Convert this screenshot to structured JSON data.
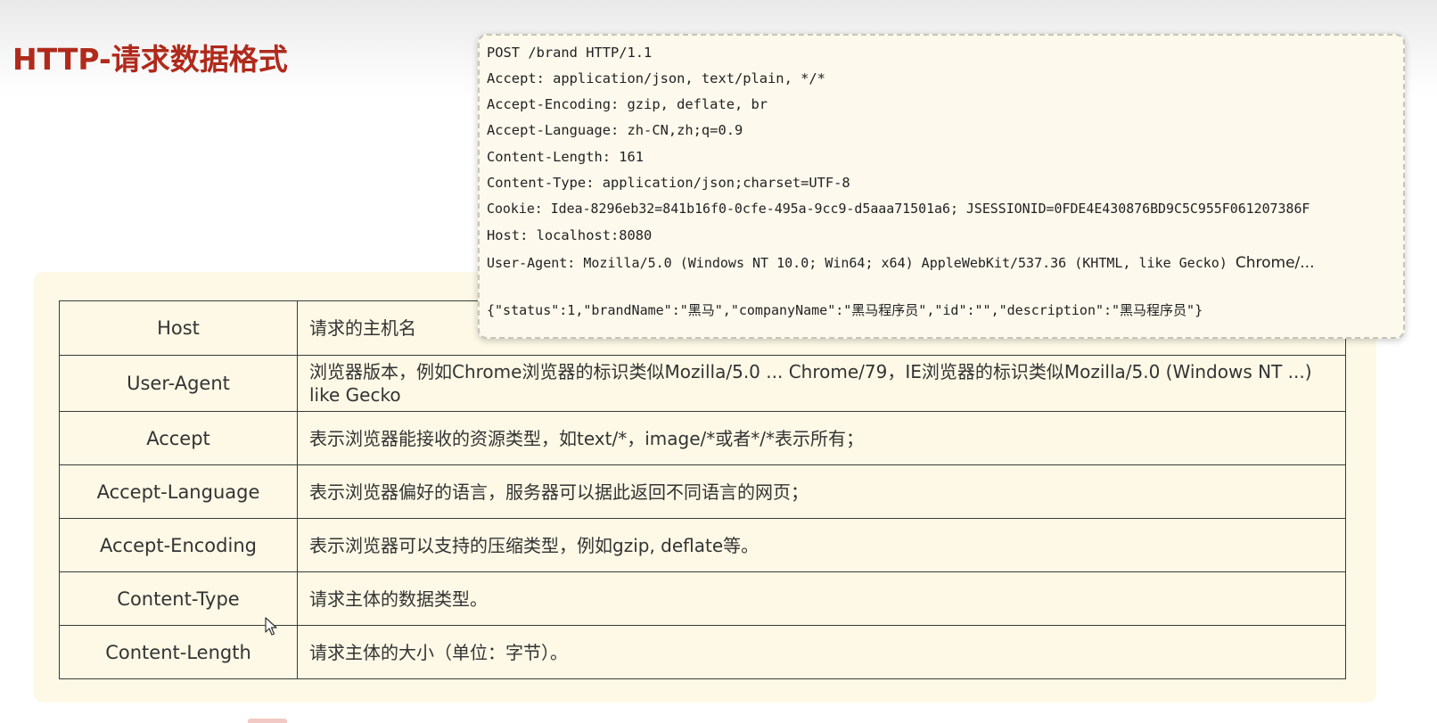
{
  "slide": {
    "title": "HTTP-请求数据格式"
  },
  "request_example": {
    "request_line": "POST /brand HTTP/1.1",
    "headers": [
      "Accept: application/json, text/plain, */*",
      "Accept-Encoding: gzip, deflate, br",
      "Accept-Language: zh-CN,zh;q=0.9",
      "Content-Length: 161",
      "Content-Type: application/json;charset=UTF-8",
      "Cookie: Idea-8296eb32=841b16f0-0cfe-495a-9cc9-d5aaa71501a6; JSESSIONID=0FDE4E430876BD9C5C955F061207386F",
      "Host: localhost:8080"
    ],
    "user_agent": "User-Agent: Mozilla/5.0 (Windows NT 10.0; Win64; x64) AppleWebKit/537.36 (KHTML, like Gecko)",
    "user_agent_tail": "Chrome/...",
    "body": "{\"status\":1,\"brandName\":\"黑马\",\"companyName\":\"黑马程序员\",\"id\":\"\",\"description\":\"黑马程序员\"}"
  },
  "header_table": {
    "rows": [
      {
        "name": "Host",
        "description": "请求的主机名"
      },
      {
        "name": "User-Agent",
        "description": "浏览器版本，例如Chrome浏览器的标识类似Mozilla/5.0 ... Chrome/79，IE浏览器的标识类似Mozilla/5.0 (Windows NT ...) like Gecko"
      },
      {
        "name": "Accept",
        "description": "表示浏览器能接收的资源类型，如text/*，image/*或者*/*表示所有；"
      },
      {
        "name": "Accept-Language",
        "description": "表示浏览器偏好的语言，服务器可以据此返回不同语言的网页；"
      },
      {
        "name": "Accept-Encoding",
        "description": "表示浏览器可以支持的压缩类型，例如gzip, deflate等。"
      },
      {
        "name": "Content-Type",
        "description": "请求主体的数据类型。"
      },
      {
        "name": "Content-Length",
        "description": "请求主体的大小（单位：字节）。"
      }
    ]
  },
  "icons": {
    "cursor": "mouse-pointer-icon"
  },
  "colors": {
    "title": "#b02a1c",
    "panel_background": "#fdf9e6",
    "popup_background": "#fdf9ed"
  }
}
